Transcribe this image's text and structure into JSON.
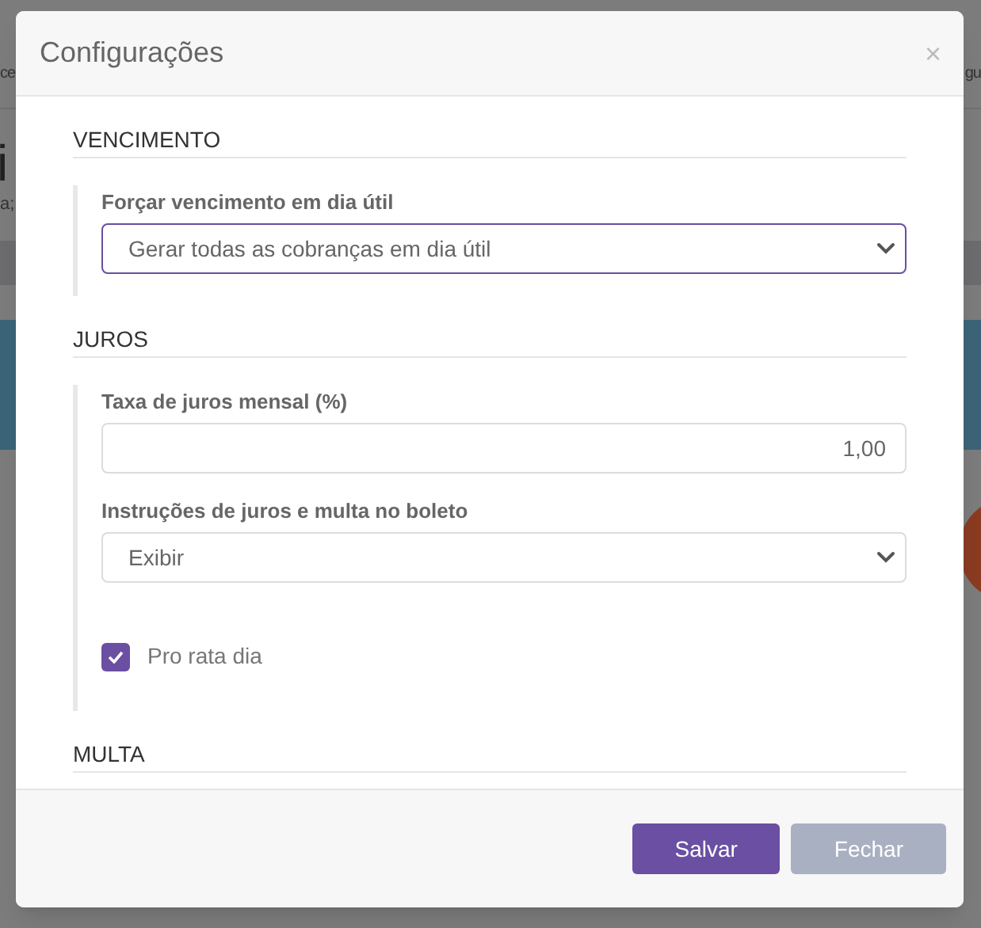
{
  "backdrop": {
    "row_left": "ce",
    "row_right": "gu",
    "heading": "i",
    "subtitle": "a;"
  },
  "modal": {
    "title": "Configurações",
    "close": "×",
    "sections": [
      {
        "title": "VENCIMENTO",
        "fields": [
          {
            "kind": "select",
            "label": "Forçar vencimento em dia útil",
            "value": "Gerar todas as cobranças em dia útil",
            "focused": true
          }
        ]
      },
      {
        "title": "JUROS",
        "fields": [
          {
            "kind": "input",
            "label": "Taxa de juros mensal (%)",
            "value": "1,00"
          },
          {
            "kind": "select",
            "label": "Instruções de juros e multa no boleto",
            "value": "Exibir",
            "focused": false
          },
          {
            "kind": "checkbox",
            "label": "Pro rata dia",
            "checked": true
          }
        ]
      },
      {
        "title": "MULTA"
      }
    ],
    "buttons": [
      {
        "label": "Salvar",
        "kind": "primary",
        "disabled": false
      },
      {
        "label": "Fechar",
        "kind": "secondary",
        "disabled": true
      }
    ]
  }
}
